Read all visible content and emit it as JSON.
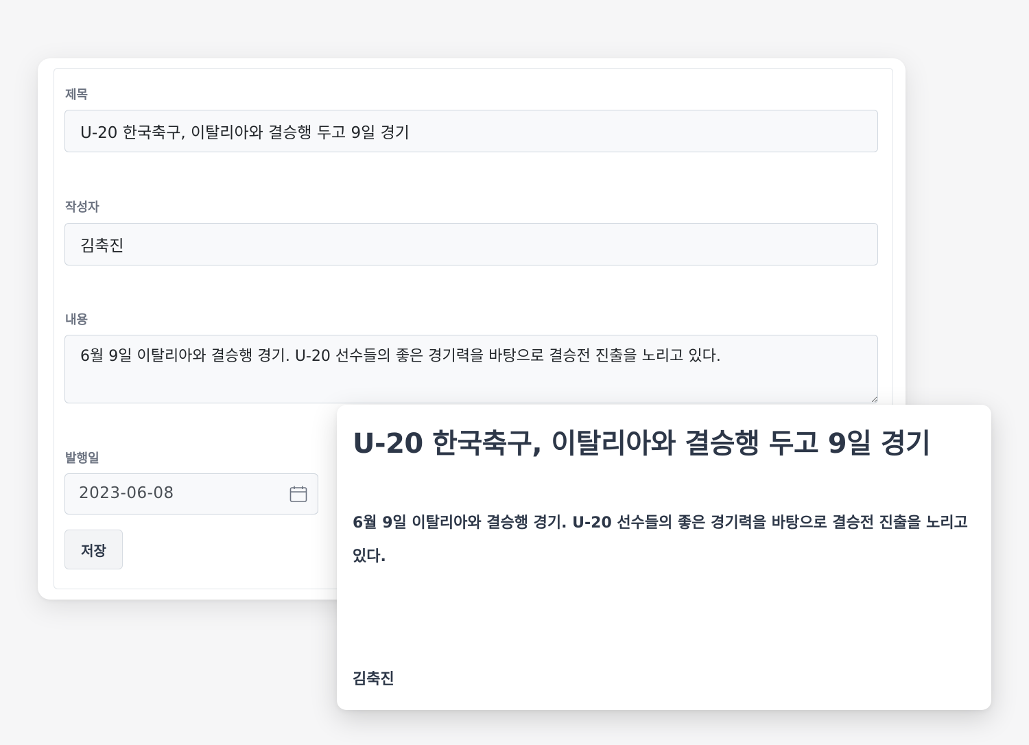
{
  "form": {
    "title_label": "제목",
    "title_value": "U-20 한국축구, 이탈리아와 결승행 두고 9일 경기",
    "author_label": "작성자",
    "author_value": "김축진",
    "content_label": "내용",
    "content_value": "6월 9일 이탈리아와 결승행 경기. U-20 선수들의 좋은 경기력을 바탕으로 결승전 진출을 노리고 있다.",
    "date_label": "발행일",
    "date_value": "2023-06-08",
    "date_icon": "calendar-icon",
    "save_label": "저장"
  },
  "preview": {
    "title": "U-20 한국축구, 이탈리아와 결승행 두고 9일 경기",
    "body": "6월 9일 이탈리아와 결승행 경기. U-20 선수들의 좋은 경기력을 바탕으로 결승전 진출을 노리고 있다.",
    "author": "김축진"
  }
}
